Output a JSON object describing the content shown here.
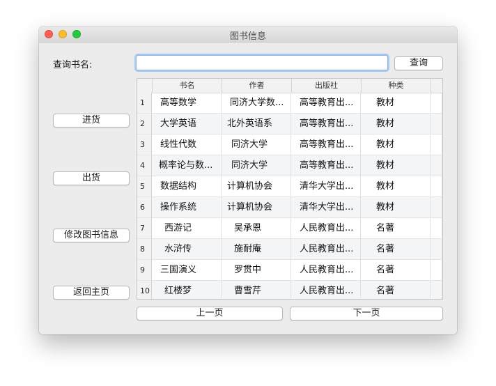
{
  "window": {
    "title": "图书信息"
  },
  "search": {
    "label": "查询书名:",
    "value": "",
    "placeholder": "",
    "button_label": "查询"
  },
  "sidebar": {
    "buttons": [
      {
        "label": "进货"
      },
      {
        "label": "出货"
      },
      {
        "label": "修改图书信息"
      },
      {
        "label": "返回主页"
      }
    ]
  },
  "table": {
    "columns": [
      "书名",
      "作者",
      "出版社",
      "种类"
    ],
    "rows": [
      {
        "num": "1",
        "title": "高等数学",
        "author": "同济大学数...",
        "publisher": "高等教育出...",
        "category": "教材"
      },
      {
        "num": "2",
        "title": "大学英语",
        "author": "北外英语系",
        "publisher": "高等教育出...",
        "category": "教材"
      },
      {
        "num": "3",
        "title": "线性代数",
        "author": "同济大学",
        "publisher": "高等教育出...",
        "category": "教材"
      },
      {
        "num": "4",
        "title": "概率论与数...",
        "author": "同济大学",
        "publisher": "高等教育出...",
        "category": "教材"
      },
      {
        "num": "5",
        "title": "数据结构",
        "author": "计算机协会",
        "publisher": "清华大学出...",
        "category": "教材"
      },
      {
        "num": "6",
        "title": "操作系统",
        "author": "计算机协会",
        "publisher": "清华大学出...",
        "category": "教材"
      },
      {
        "num": "7",
        "title": "西游记",
        "author": "吴承恩",
        "publisher": "人民教育出...",
        "category": "名著"
      },
      {
        "num": "8",
        "title": "水浒传",
        "author": "施耐庵",
        "publisher": "人民教育出...",
        "category": "名著"
      },
      {
        "num": "9",
        "title": "三国演义",
        "author": "罗贯中",
        "publisher": "人民教育出...",
        "category": "名著"
      },
      {
        "num": "10",
        "title": "红楼梦",
        "author": "曹雪芹",
        "publisher": "人民教育出...",
        "category": "名著"
      }
    ]
  },
  "pagination": {
    "prev_label": "上一页",
    "next_label": "下一页"
  }
}
